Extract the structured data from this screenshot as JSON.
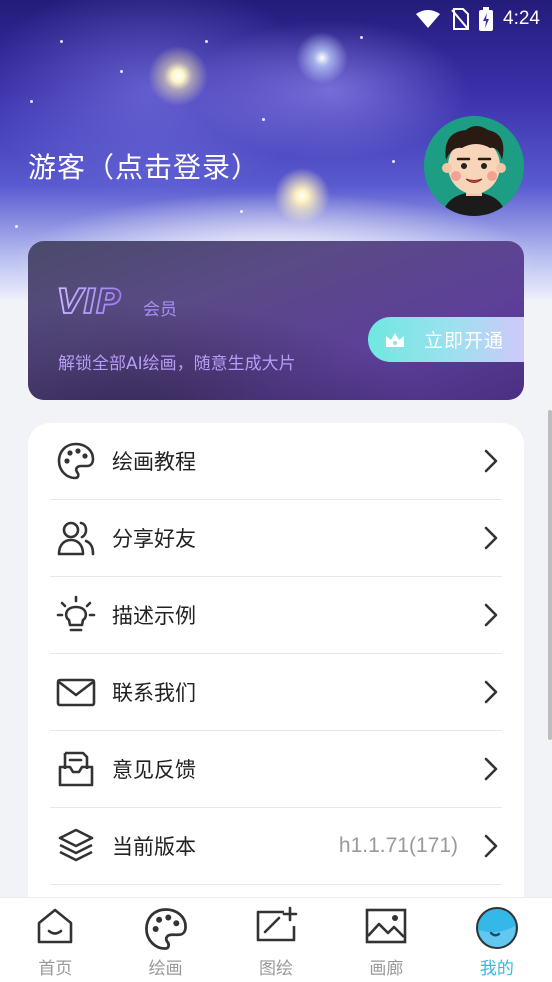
{
  "status_bar": {
    "time": "4:24"
  },
  "profile": {
    "name": "游客（点击登录）"
  },
  "vip": {
    "logo_text": "VIP",
    "member_label": "会员",
    "description": "解锁全部AI绘画，随意生成大片",
    "button_label": "立即开通"
  },
  "menu": {
    "items": [
      {
        "label": "绘画教程",
        "icon": "palette-icon"
      },
      {
        "label": "分享好友",
        "icon": "users-icon"
      },
      {
        "label": "描述示例",
        "icon": "lightbulb-icon"
      },
      {
        "label": "联系我们",
        "icon": "mail-icon"
      },
      {
        "label": "意见反馈",
        "icon": "feedback-icon"
      },
      {
        "label": "当前版本",
        "icon": "layers-icon",
        "value": "h1.1.71(171)"
      }
    ]
  },
  "tabs": [
    {
      "label": "首页",
      "icon": "home-icon"
    },
    {
      "label": "绘画",
      "icon": "palette-icon"
    },
    {
      "label": "图绘",
      "icon": "draw-board-icon"
    },
    {
      "label": "画廊",
      "icon": "gallery-icon"
    },
    {
      "label": "我的",
      "icon": "profile-icon",
      "active": true
    }
  ],
  "colors": {
    "accent": "#35b7e8",
    "vip_purple": "#a98ef3"
  }
}
